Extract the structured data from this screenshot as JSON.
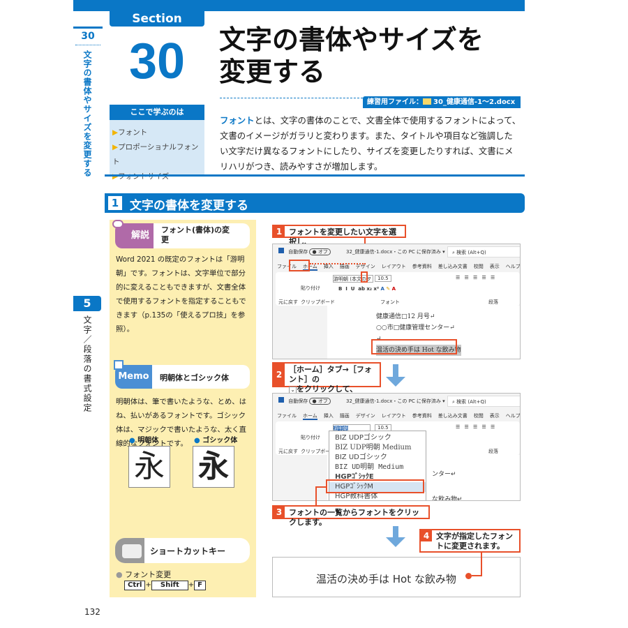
{
  "colors": {
    "accent": "#0a77c6",
    "step": "#e8502a",
    "panel": "#fdefb2",
    "learn_bg": "#d6e8f6"
  },
  "sidebar": {
    "section_no": "30",
    "section_title": "文字の書体やサイズを変更する",
    "chapter_no": "5",
    "chapter_title": "文字／段落の書式設定"
  },
  "header": {
    "section_label": "Section",
    "number": "30",
    "title_line1": "文字の書体やサイズを",
    "title_line2": "変更する",
    "file_label": "練習用ファイル：",
    "file_icon": "folder-icon",
    "file_name": "30_健康通信-1～2.docx"
  },
  "learn": {
    "title": "ここで学ぶのは",
    "items": [
      "フォント",
      "プロポーショナルフォント",
      "フォントサイズ"
    ]
  },
  "intro": {
    "highlight": "フォント",
    "text": "とは、文字の書体のことで、文書全体で使用するフォントによって、文書のイメージがガラリと変わります。また、タイトルや項目など強調したい文字だけ異なるフォントにしたり、サイズを変更したりすれば、文書にメリハリがつき、読みやすさが増加します。"
  },
  "heading": {
    "number": "1",
    "text": "文字の書体を変更する"
  },
  "kaisetsu": {
    "badge": "解説",
    "title": "フォント(書体)の変更",
    "body": "Word 2021 の既定のフォントは「游明朝」です。フォントは、文字単位で部分的に変えることもできますが、文書全体で使用するフォントを指定することもできます（p.135の「使えるプロ技」を参照）。"
  },
  "memo": {
    "badge": "Memo",
    "title": "明朝体とゴシック体",
    "body": "明朝体は、筆で書いたような、とめ、はね、払いがあるフォントです。ゴシック体は、マジックで書いたような、太く直線的なフォントです。",
    "mincho_label": "明朝体",
    "gothic_label": "ゴシック体",
    "sample_char": "永"
  },
  "shortcut": {
    "title": "ショートカットキー",
    "item": "フォント変更",
    "keys": [
      "Ctrl",
      "Shift",
      "F"
    ],
    "plus": "+"
  },
  "steps": [
    {
      "n": "1",
      "text": "フォントを変更したい文字を選択し、"
    },
    {
      "n": "2",
      "text": "［ホーム］タブ→［フォント］の",
      "text2": "をクリックして、"
    },
    {
      "n": "3",
      "text": "フォントの一覧からフォントをクリックします。"
    },
    {
      "n": "4",
      "text": "文字が指定したフォントに変更されます。"
    }
  ],
  "word": {
    "autosave": "自動保存",
    "toggle": "オフ",
    "filename": "32_健康通信-1.docx・この PC に保存済み ▾",
    "search": "検索 (Alt+Q)",
    "tabs": [
      "ファイル",
      "ホーム",
      "挿入",
      "描画",
      "デザイン",
      "レイアウト",
      "参考資料",
      "差し込み文書",
      "校閲",
      "表示",
      "ヘルプ"
    ],
    "font_box": "游明朝 (本文のフォ",
    "font_box2": "游明朝",
    "size": "10.5",
    "undo_group": "元に戻す",
    "clipboard_group": "クリップボード",
    "paste": "貼り付け",
    "font_group": "フォント",
    "para_group": "段落",
    "doc_lines": [
      "健康通信□12 月号↵",
      "○○市□健康管理センター↵",
      "↵"
    ],
    "selected_text": "温活の決め手は Hot な飲み物",
    "font_list": [
      "BIZ UDPゴシック",
      "BIZ UDP明朝 Medium",
      "BIZ UDゴシック",
      "BIZ UD明朝 Medium",
      "HGPｺﾞｼｯｸE",
      "HGPｺﾞｼｯｸM",
      "HGP教科書体"
    ],
    "font_selected": "HGPｺﾞｼｯｸM",
    "partial_lines": [
      "ンター↵",
      "な飲み物↵"
    ],
    "result_text": "温活の決め手は Hot な飲み物"
  },
  "page_number": "132"
}
